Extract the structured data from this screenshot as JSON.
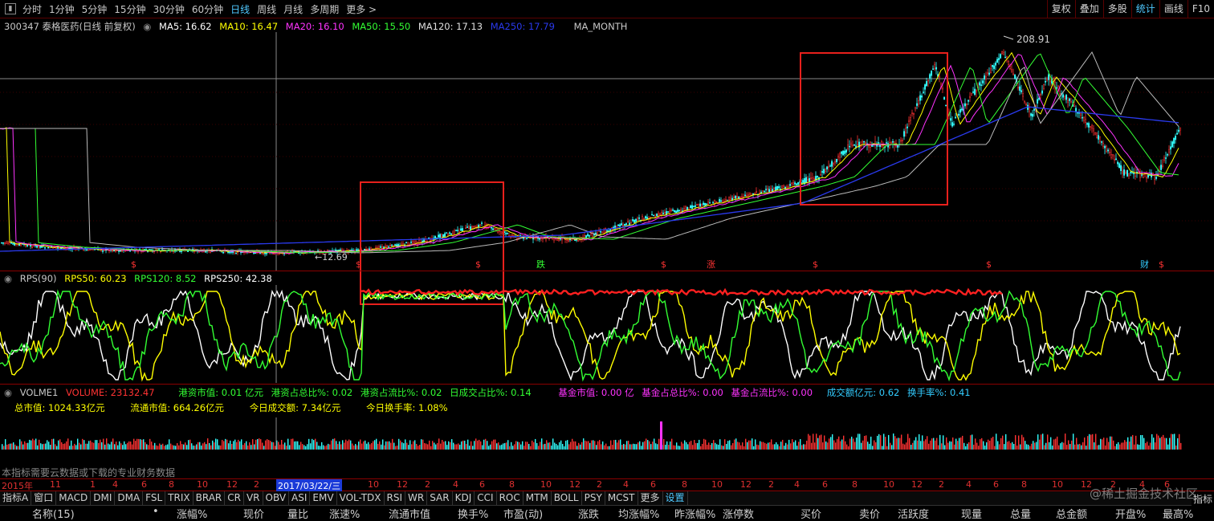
{
  "toolbar": {
    "periods": [
      "分时",
      "1分钟",
      "5分钟",
      "15分钟",
      "30分钟",
      "60分钟",
      "日线",
      "周线",
      "月线",
      "多周期",
      "更多 >"
    ],
    "selected_period": "日线",
    "right_tools": [
      "复权",
      "叠加",
      "多股",
      "统计",
      "画线",
      "F10"
    ],
    "highlighted_tool": "统计"
  },
  "main_legend": {
    "code_name": "300347 泰格医药(日线 前复权)",
    "ma5": "MA5: 16.62",
    "ma5_color": "#ffffff",
    "ma10": "MA10: 16.47",
    "ma10_color": "#ffff00",
    "ma20": "MA20: 16.10",
    "ma20_color": "#ff33ff",
    "ma50": "MA50: 15.50",
    "ma50_color": "#33ff33",
    "ma120": "MA120: 17.13",
    "ma120_color": "#e0e0e0",
    "ma250": "MA250: 17.79",
    "ma250_color": "#2233dd",
    "ma_month": "MA_MONTH"
  },
  "price_labels": {
    "high": "208.91",
    "low": "12.69"
  },
  "markers": [
    "$",
    "$",
    "$",
    "跌",
    "$",
    "涨",
    "$",
    "$",
    "财",
    "$"
  ],
  "rps_legend": {
    "title": "RPS(90)",
    "rps50": "RPS50: 60.23",
    "rps120": "RPS120: 8.52",
    "rps250": "RPS250: 42.38"
  },
  "vol_legend": {
    "title": "VOLME1",
    "volume": "VOLUME: 23132.47",
    "hk_value": "港资市值: 0.01 亿元",
    "hk_total": "港资占总比%: 0.02",
    "hk_float": "港资占流比%: 0.02",
    "daily_trade": "日成交占比%: 0.14",
    "fund_value": "基金市值: 0.00 亿",
    "fund_total": "基金占总比%: 0.00",
    "fund_float": "基金占流比%: 0.00",
    "turnover_amount": "成交额亿元: 0.62",
    "turnover_rate": "换手率%: 0.41"
  },
  "stats_line": {
    "total_cap": "总市值: 1024.33亿元",
    "float_cap": "流通市值: 664.26亿元",
    "today_amount": "今日成交额: 7.34亿元",
    "today_rate": "今日换手率: 1.08%"
  },
  "note": "本指标需要云数据或下载的专业财务数据",
  "time_axis": {
    "start": "2015年",
    "cursor": "2017/03/22/三",
    "ticks": [
      "11",
      "1",
      "4",
      "6",
      "8",
      "10",
      "12",
      "2",
      "10",
      "12",
      "2",
      "4",
      "6",
      "8",
      "10",
      "12",
      "2",
      "4",
      "6",
      "8",
      "10",
      "12",
      "2",
      "4",
      "6",
      "8",
      "10",
      "12",
      "2",
      "4",
      "6",
      "8",
      "10",
      "12",
      "2",
      "4",
      "6"
    ]
  },
  "indicator_tabs": [
    "指标A",
    "窗口",
    "MACD",
    "DMI",
    "DMA",
    "FSL",
    "TRIX",
    "BRAR",
    "CR",
    "VR",
    "OBV",
    "ASI",
    "EMV",
    "VOL-TDX",
    "RSI",
    "WR",
    "SAR",
    "KDJ",
    "CCI",
    "ROC",
    "MTM",
    "BOLL",
    "PSY",
    "MCST",
    "更多",
    "设置"
  ],
  "columns": [
    "名称(15)",
    "•",
    "涨幅%",
    "现价",
    "量比",
    "涨速%",
    "流通市值",
    "换手%",
    "市盈(动)",
    "涨跌",
    "均涨幅%",
    "昨涨幅%",
    "涨停数",
    "买价",
    "卖价",
    "活跃度",
    "现量",
    "总量",
    "总金额",
    "开盘%",
    "最高%"
  ],
  "watermark": "@稀土掘金技术社区",
  "right_edge_label": "指标"
}
